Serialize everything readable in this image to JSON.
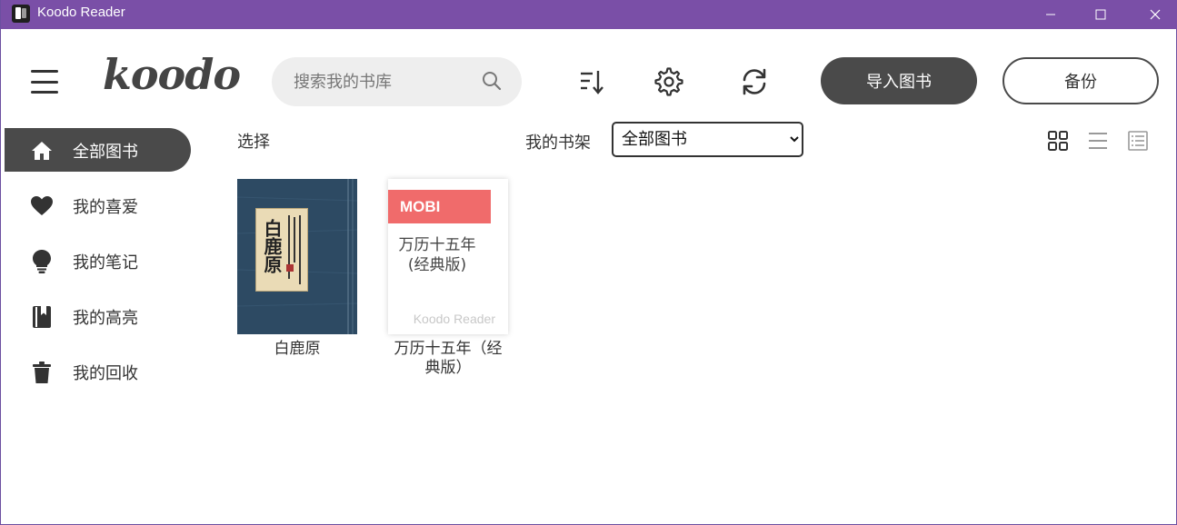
{
  "window": {
    "title": "Koodo Reader"
  },
  "header": {
    "logo": "koodo",
    "search_placeholder": "搜索我的书库",
    "import_label": "导入图书",
    "backup_label": "备份"
  },
  "sidebar": {
    "items": [
      {
        "label": "全部图书",
        "icon": "home-icon",
        "active": true
      },
      {
        "label": "我的喜爱",
        "icon": "heart-icon",
        "active": false
      },
      {
        "label": "我的笔记",
        "icon": "lightbulb-icon",
        "active": false
      },
      {
        "label": "我的高亮",
        "icon": "bookmark-book-icon",
        "active": false
      },
      {
        "label": "我的回收",
        "icon": "trash-icon",
        "active": false
      }
    ]
  },
  "toolbar": {
    "select_label": "选择",
    "shelf_label": "我的书架",
    "shelf_selected": "全部图书"
  },
  "books": [
    {
      "name": "白鹿原",
      "cover_text": "白鹿原"
    },
    {
      "name": "万历十五年（经典版）",
      "format_badge": "MOBI",
      "cover_title": "万历十五年(经典版)",
      "brand": "Koodo Reader"
    }
  ],
  "colors": {
    "titlebar": "#7a4fa7",
    "accent_dark": "#4a4a4a",
    "badge": "#f06b6b"
  }
}
